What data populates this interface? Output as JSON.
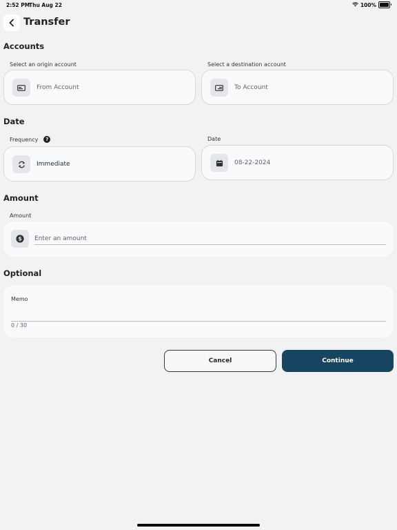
{
  "status_bar": {
    "time": "2:52 PM",
    "date": "Thu Aug 22",
    "battery": "100%"
  },
  "header": {
    "title": "Transfer"
  },
  "accounts": {
    "section_title": "Accounts",
    "origin_label": "Select an origin account",
    "origin_placeholder": "From Account",
    "destination_label": "Select a destination account",
    "destination_placeholder": "To Account"
  },
  "date_section": {
    "section_title": "Date",
    "frequency_label": "Frequency",
    "frequency_help": "?",
    "frequency_value": "Immediate",
    "date_label": "Date",
    "date_value": "08-22-2024"
  },
  "amount": {
    "section_title": "Amount",
    "label": "Amount",
    "placeholder": "Enter an amount"
  },
  "optional": {
    "section_title": "Optional",
    "memo_label": "Memo",
    "memo_counter": "0 / 30"
  },
  "actions": {
    "cancel_label": "Cancel",
    "continue_label": "Continue"
  },
  "colors": {
    "primary": "#174461",
    "background": "#f2f2f2",
    "card": "#f9fafb"
  }
}
